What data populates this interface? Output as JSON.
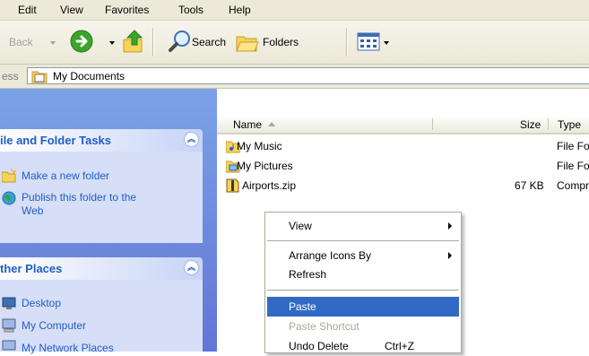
{
  "menubar": {
    "items": [
      "Edit",
      "View",
      "Favorites",
      "Tools",
      "Help"
    ]
  },
  "toolbar": {
    "back_label": "Back",
    "search_label": "Search",
    "folders_label": "Folders"
  },
  "addressbar": {
    "label_partial": "ess",
    "value": "My Documents"
  },
  "taskpane": {
    "file_tasks": {
      "title": "ile and Folder Tasks",
      "items": [
        "Make a new folder",
        "Publish this folder to the",
        "Web"
      ]
    },
    "other_places": {
      "title": "ther Places",
      "items": [
        "Desktop",
        "My Computer",
        "My Network Places"
      ]
    }
  },
  "listview": {
    "columns": {
      "name": "Name",
      "size": "Size",
      "type": "Type"
    },
    "files": [
      {
        "name": "My Music",
        "size": "",
        "type": "File Fo"
      },
      {
        "name": "My Pictures",
        "size": "",
        "type": "File Fo"
      },
      {
        "name": "Airports.zip",
        "size": "67 KB",
        "type": "Compr"
      }
    ]
  },
  "context_menu": {
    "view": "View",
    "arrange": "Arrange Icons By",
    "refresh": "Refresh",
    "paste": "Paste",
    "paste_shortcut": "Paste Shortcut",
    "undo": "Undo Delete",
    "undo_shortcut": "Ctrl+Z"
  },
  "colors": {
    "highlight": "#316ac5",
    "taskpane_link": "#215dc6",
    "taskpane_bg": "#7ba2e7"
  }
}
